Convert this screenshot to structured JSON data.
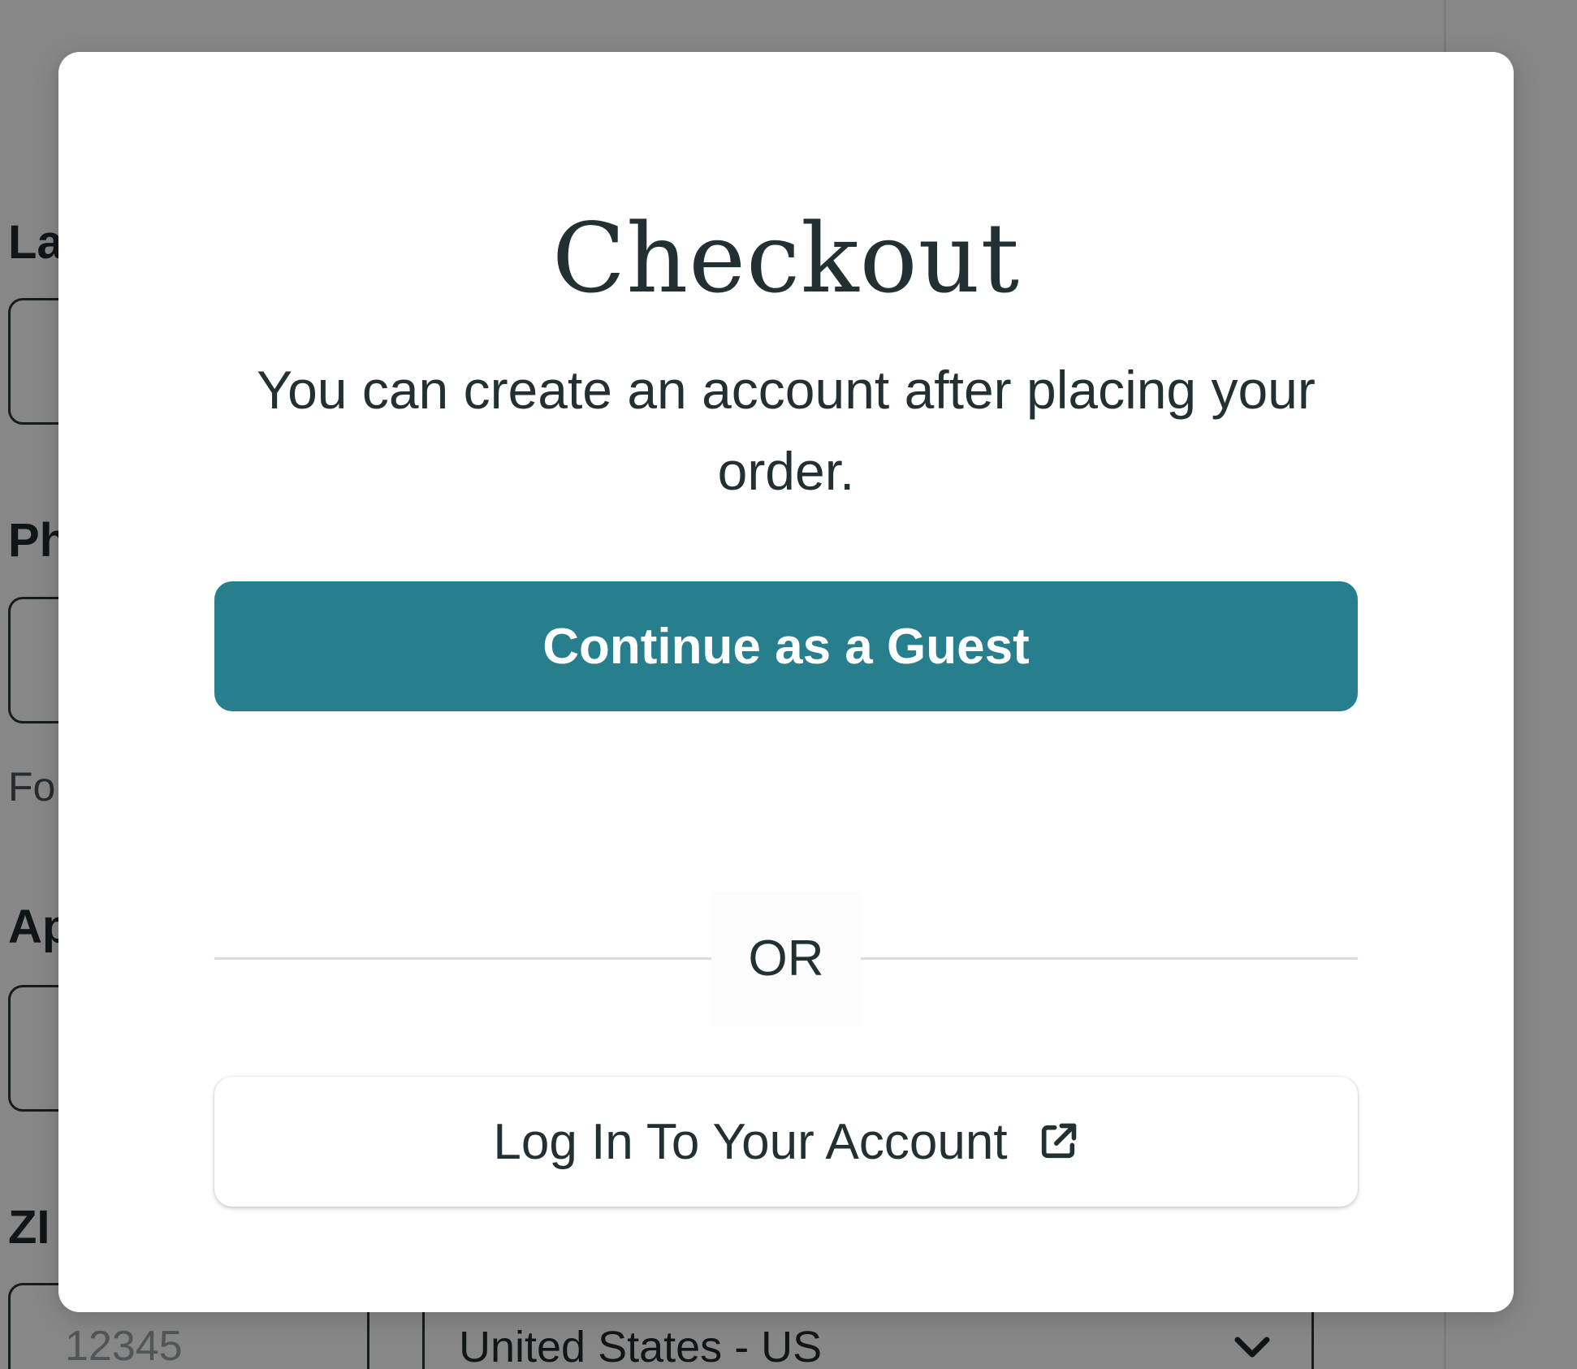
{
  "background_form": {
    "labels": [
      "La",
      "Ph",
      "Ap",
      "ZI"
    ],
    "help_text": "Fo",
    "zip_placeholder": "12345",
    "country_value": "United States - US"
  },
  "modal": {
    "title": "Checkout",
    "subtitle": "You can create an account after placing your order.",
    "guest_button_label": "Continue as a Guest",
    "divider_text": "OR",
    "login_button_label": "Log In To Your Account",
    "login_icon": "external-link-icon"
  },
  "colors": {
    "primary_button": "#277e8c",
    "overlay": "rgba(0,0,0,0.47)",
    "text": "#223034"
  }
}
